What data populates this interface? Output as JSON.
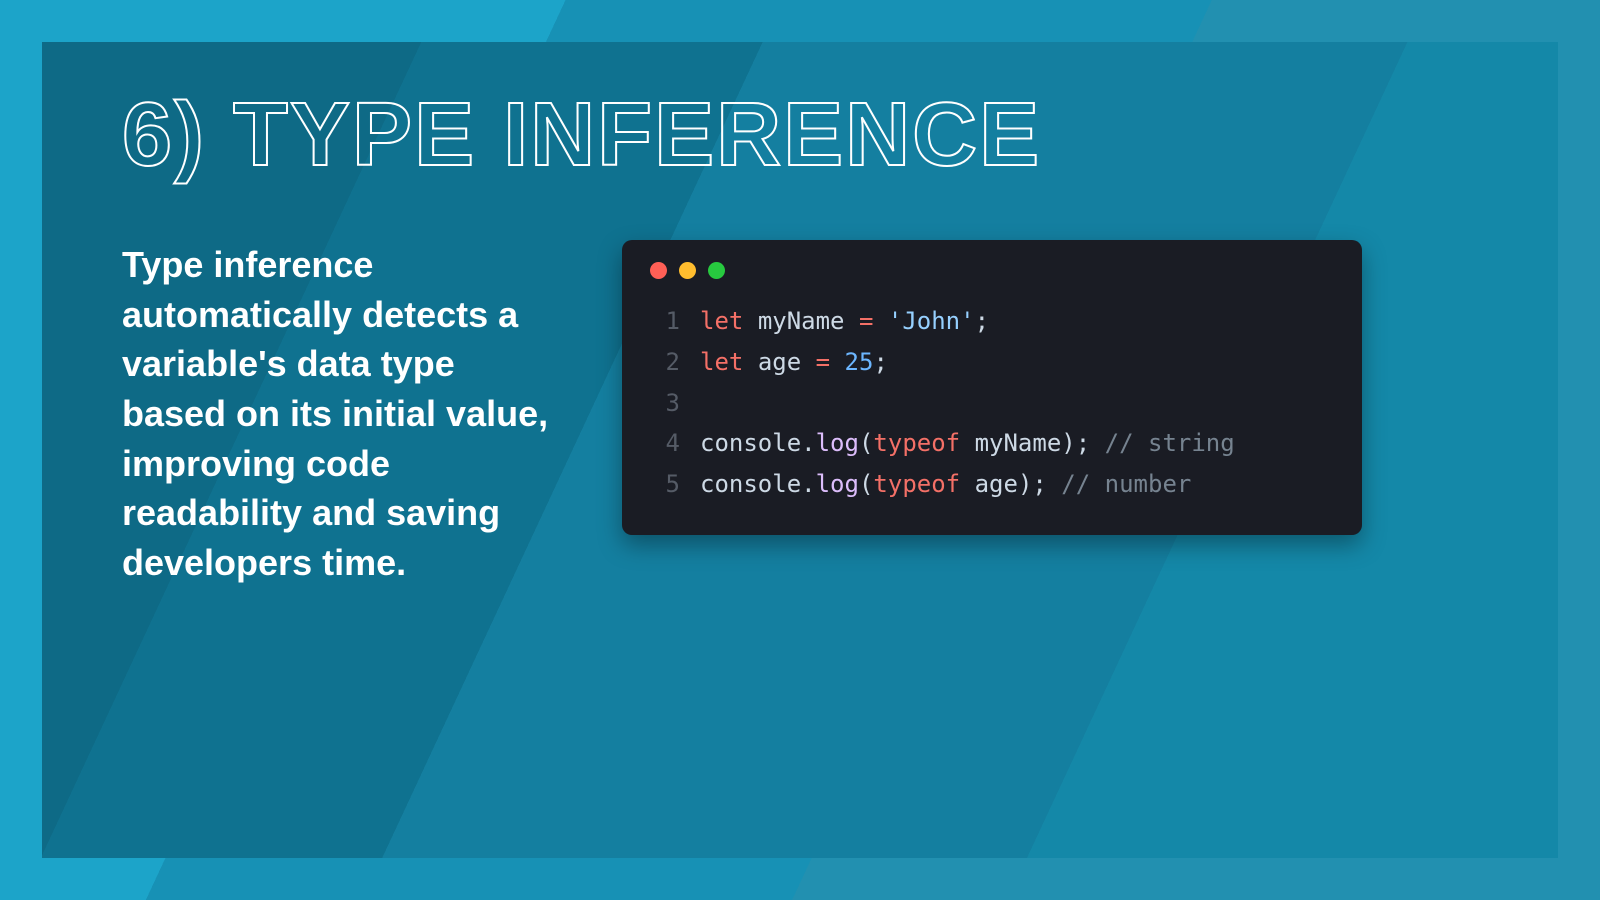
{
  "slide": {
    "title": "6) TYPE INFERENCE",
    "description": "Type inference automatically detects a variable's data type based on its initial value, improving code readability and saving developers time."
  },
  "code": {
    "window_buttons": [
      "red",
      "yellow",
      "green"
    ],
    "lines": [
      {
        "n": "1",
        "tokens": [
          {
            "c": "kw",
            "t": "let"
          },
          {
            "c": "",
            "t": " "
          },
          {
            "c": "id",
            "t": "myName"
          },
          {
            "c": "",
            "t": " "
          },
          {
            "c": "op",
            "t": "="
          },
          {
            "c": "",
            "t": " "
          },
          {
            "c": "str",
            "t": "'John'"
          },
          {
            "c": "pn",
            "t": ";"
          }
        ]
      },
      {
        "n": "2",
        "tokens": [
          {
            "c": "kw",
            "t": "let"
          },
          {
            "c": "",
            "t": " "
          },
          {
            "c": "id",
            "t": "age"
          },
          {
            "c": "",
            "t": " "
          },
          {
            "c": "op",
            "t": "="
          },
          {
            "c": "",
            "t": " "
          },
          {
            "c": "num",
            "t": "25"
          },
          {
            "c": "pn",
            "t": ";"
          }
        ]
      },
      {
        "n": "3",
        "tokens": []
      },
      {
        "n": "4",
        "tokens": [
          {
            "c": "id",
            "t": "console"
          },
          {
            "c": "pn",
            "t": "."
          },
          {
            "c": "fn",
            "t": "log"
          },
          {
            "c": "pn",
            "t": "("
          },
          {
            "c": "kw",
            "t": "typeof"
          },
          {
            "c": "",
            "t": " "
          },
          {
            "c": "id",
            "t": "myName"
          },
          {
            "c": "pn",
            "t": ");"
          },
          {
            "c": "",
            "t": "  "
          },
          {
            "c": "cm",
            "t": "// string"
          }
        ]
      },
      {
        "n": "5",
        "tokens": [
          {
            "c": "id",
            "t": "console"
          },
          {
            "c": "pn",
            "t": "."
          },
          {
            "c": "fn",
            "t": "log"
          },
          {
            "c": "pn",
            "t": "("
          },
          {
            "c": "kw",
            "t": "typeof"
          },
          {
            "c": "",
            "t": " "
          },
          {
            "c": "id",
            "t": "age"
          },
          {
            "c": "pn",
            "t": ");"
          },
          {
            "c": "",
            "t": "  "
          },
          {
            "c": "cm",
            "t": "// number"
          }
        ]
      }
    ]
  }
}
